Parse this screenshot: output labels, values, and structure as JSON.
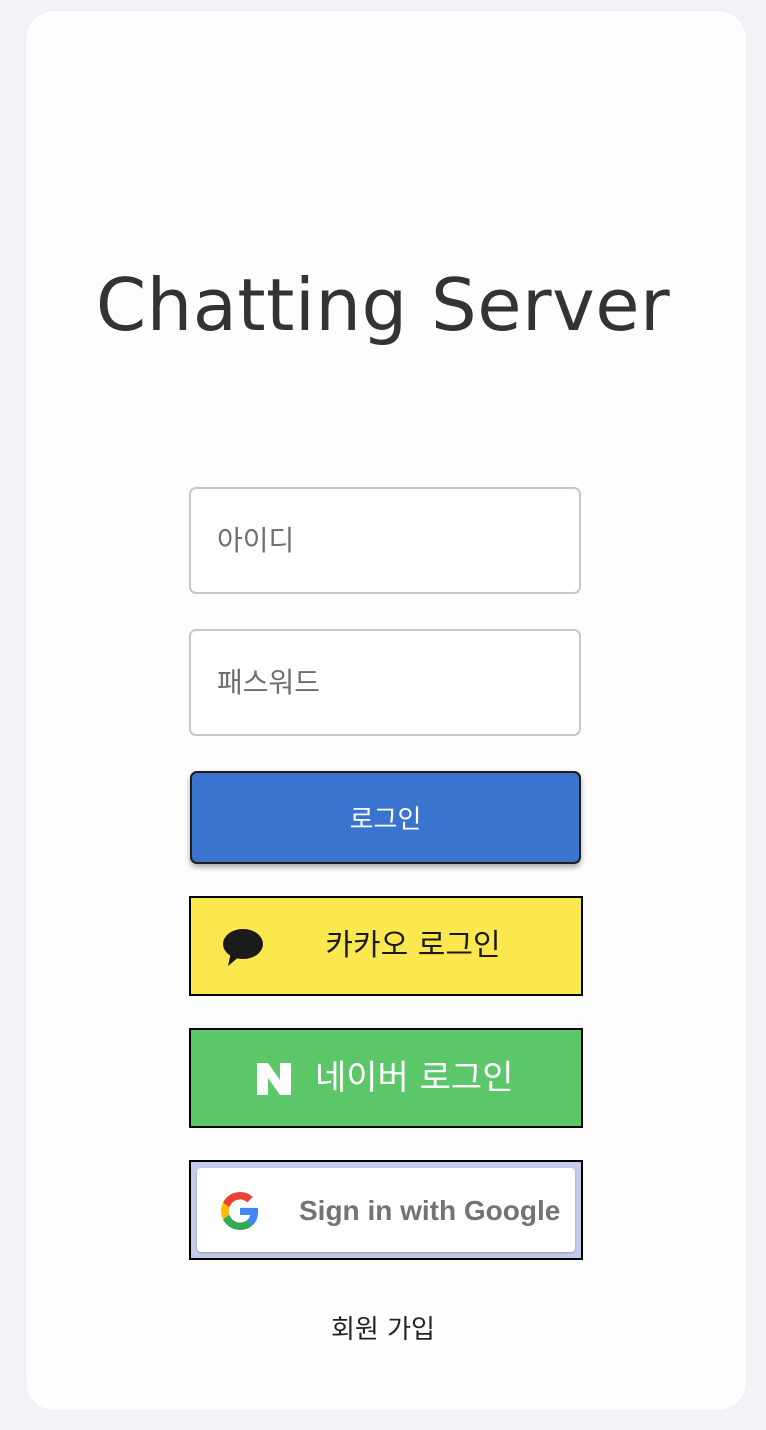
{
  "app": {
    "title": "Chatting Server"
  },
  "form": {
    "id_placeholder": "아이디",
    "id_value": "",
    "password_placeholder": "패스워드",
    "password_value": "",
    "login_label": "로그인"
  },
  "social": {
    "kakao": {
      "label": "카카오 로그인",
      "icon": "kakao-bubble-icon",
      "color": "#fae84e"
    },
    "naver": {
      "label": "네이버 로그인",
      "icon": "naver-n-icon",
      "color": "#5bc769"
    },
    "google": {
      "label": "Sign in with Google",
      "icon": "google-g-icon",
      "color": "#c3cde9"
    }
  },
  "footer": {
    "signup_label": "회원 가입"
  },
  "colors": {
    "primary": "#3a74ce",
    "background": "#f2f3f6",
    "card": "#fdfdfd"
  }
}
